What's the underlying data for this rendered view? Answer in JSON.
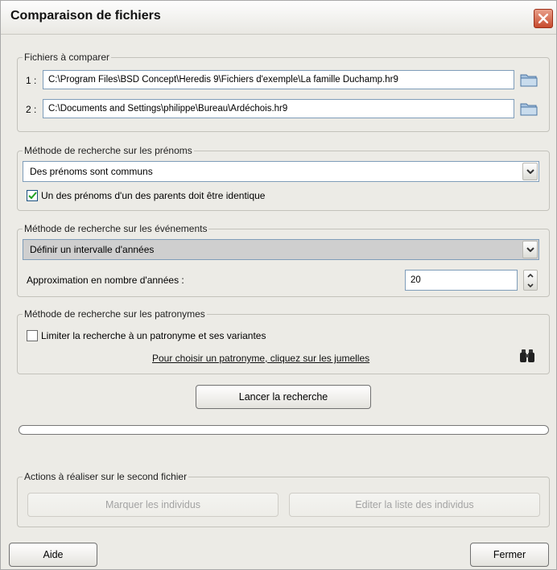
{
  "window": {
    "title": "Comparaison de fichiers"
  },
  "files_group": {
    "legend": "Fichiers à comparer",
    "file1_label": "1 :",
    "file1_value": "C:\\Program Files\\BSD Concept\\Heredis 9\\Fichiers d'exemple\\La famille Duchamp.hr9",
    "file2_label": "2 :",
    "file2_value": "C:\\Documents and Settings\\philippe\\Bureau\\Ardéchois.hr9",
    "icons": [
      "folder-icon",
      "folder-icon"
    ]
  },
  "firstname_group": {
    "legend": "Méthode de recherche sur les prénoms",
    "selected": "Des prénoms sont communs",
    "checkbox_label": "Un des prénoms d'un des parents doit être identique",
    "checkbox_checked": true
  },
  "events_group": {
    "legend": "Méthode de recherche sur les événements",
    "selected": "Définir un intervalle d'années",
    "approx_label": "Approximation en nombre d'années :",
    "approx_value": "20"
  },
  "surname_group": {
    "legend": "Méthode de recherche sur les patronymes",
    "checkbox_label": "Limiter la recherche à un patronyme et ses variantes",
    "checkbox_checked": false,
    "link_text": "Pour choisir un patronyme, cliquez sur les jumelles",
    "icon": "binoculars-icon"
  },
  "search_button": "Lancer la recherche",
  "progress": {
    "value": 0
  },
  "actions_group": {
    "legend": "Actions à réaliser sur le second fichier",
    "mark_button": "Marquer les individus",
    "edit_button": "Editer la liste des individus"
  },
  "footer": {
    "help_button": "Aide",
    "close_button": "Fermer"
  },
  "colors": {
    "close_button": "#c74b2e",
    "checkmark": "#21a121",
    "folder": "#7fa3c8"
  }
}
